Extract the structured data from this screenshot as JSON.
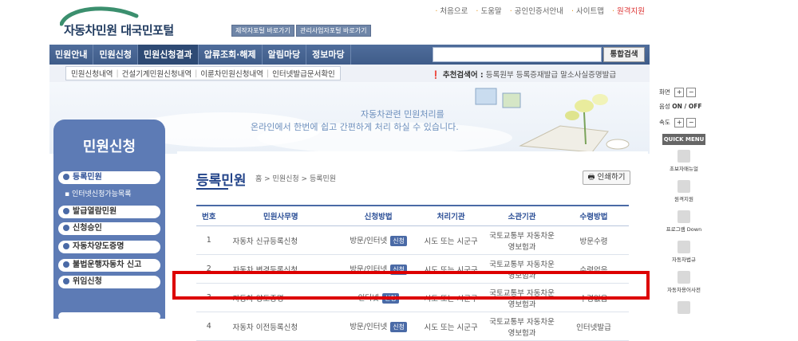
{
  "header": {
    "logo_text": "자동차민원 대국민포털",
    "quick_link_1": "제작자포털 바로가기",
    "quick_link_2": "관리사업자포털 바로가기",
    "util_links": [
      "처음으로",
      "도움말",
      "공인인증서안내",
      "사이트맵"
    ],
    "remote_support": "원격지원"
  },
  "main_nav": {
    "items": [
      "민원안내",
      "민원신청",
      "민원신청결과",
      "압류조회·해제",
      "알림마당",
      "정보마당"
    ],
    "active": "민원신청결과"
  },
  "search": {
    "value": "",
    "button_label": "통합검색"
  },
  "sub_nav": {
    "links": [
      "민원신청내역",
      "건설기계민원신청내역",
      "이륜차민원신청내역",
      "인터넷발급문서확인"
    ],
    "recommend_label": "추천검색어 :",
    "recommend_terms": "등록원부 등록증재발급 말소사실증명발급"
  },
  "banner": {
    "line1": "자동차관련 민원처리를",
    "line2": "온라인에서 한번에 쉽고 간편하게 처리 하실 수 있습니다."
  },
  "left_menu": {
    "title": "민원신청",
    "items": [
      "등록민원",
      "발급열람민원",
      "신청승인",
      "자동차양도증명",
      "불법운행자동차 신고",
      "위임신청"
    ],
    "sub_item": "인터넷신청가능목록"
  },
  "content": {
    "title": "등록민원",
    "breadcrumb": [
      "홈",
      "민원신청",
      "등록민원"
    ],
    "print_label": "인쇄하기",
    "table": {
      "headers": [
        "번호",
        "민원사무명",
        "신청방법",
        "처리기관",
        "소관기관",
        "수령방법"
      ],
      "apply_label": "신청",
      "rows": [
        {
          "no": "1",
          "name": "자동차 신규등록신청",
          "method": "방문/인터넷",
          "org": "시도 또는 시군구",
          "dept": "국토교통부 자동차운영보험과",
          "receive": "방문수령"
        },
        {
          "no": "2",
          "name": "자동차 변경등록신청",
          "method": "방문/인터넷",
          "org": "시도 또는 시군구",
          "dept": "국토교통부 자동차운영보험과",
          "receive": "수령없음"
        },
        {
          "no": "3",
          "name": "자동차 양도증명",
          "method": "인터넷",
          "org": "시도 또는 시군구",
          "dept": "국토교통부 자동차운영보험과",
          "receive": "수령없음"
        },
        {
          "no": "4",
          "name": "자동차 이전등록신청",
          "method": "방문/인터넷",
          "org": "시도 또는 시군구",
          "dept": "국토교통부 자동차운영보험과",
          "receive": "인터넷발급"
        }
      ]
    }
  },
  "right_panel": {
    "zoom_label": "화면",
    "voice_label": "음성",
    "voice_state": "ON / OFF",
    "speed_label": "속도",
    "quick_menu_title": "QUICK MENU",
    "quick_items": [
      "초보자매뉴얼",
      "원격지원",
      "프로그램 Down",
      "자동차법규",
      "자동차용어사전"
    ]
  }
}
